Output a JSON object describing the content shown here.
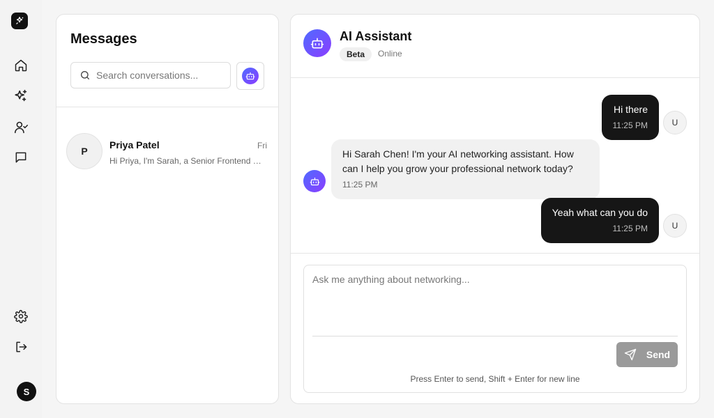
{
  "sidebar": {
    "nav_icons": [
      "home-icon",
      "sparkles-icon",
      "user-check-icon",
      "message-square-icon"
    ],
    "bottom_icons": [
      "settings-icon",
      "log-out-icon"
    ],
    "profile_initial": "S"
  },
  "conversations": {
    "title": "Messages",
    "search_placeholder": "Search conversations...",
    "items": [
      {
        "initial": "P",
        "name": "Priya Patel",
        "time": "Fri",
        "preview": "Hi Priya, I'm Sarah, a Senior Frontend Developer"
      }
    ]
  },
  "chat": {
    "title": "AI Assistant",
    "badge": "Beta",
    "status": "Online",
    "user_initial": "U",
    "messages": [
      {
        "from": "user",
        "text": "Hi there",
        "time": "11:25 PM"
      },
      {
        "from": "bot",
        "text": "Hi Sarah Chen! I'm your AI networking assistant. How can I help you grow your professional network today?",
        "time": "11:25 PM"
      },
      {
        "from": "user",
        "text": "Yeah what can you do",
        "time": "11:25 PM"
      }
    ],
    "composer": {
      "placeholder": "Ask me anything about networking...",
      "send_label": "Send",
      "hint": "Press Enter to send, Shift + Enter for new line"
    }
  },
  "colors": {
    "accent_gradient_start": "#4f6bff",
    "accent_gradient_end": "#8b3dff",
    "user_bubble": "#161616",
    "bot_bubble": "#f1f1f1",
    "send_button": "#9a9a9a"
  }
}
